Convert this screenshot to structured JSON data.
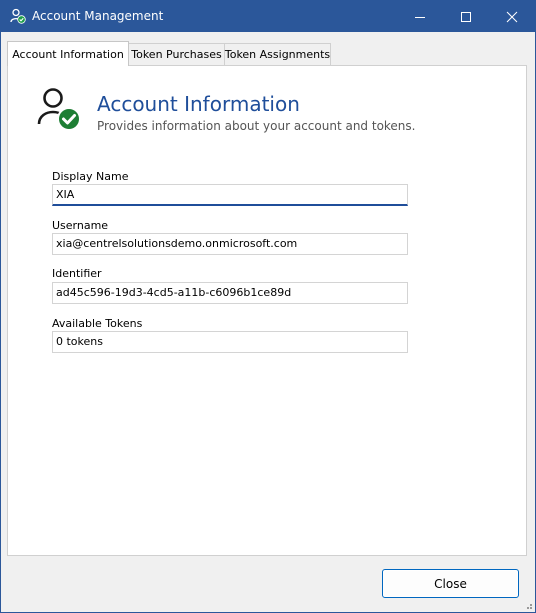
{
  "window": {
    "title": "Account Management"
  },
  "title_buttons": {
    "minimize_icon": "minimize-icon",
    "maximize_icon": "maximize-icon",
    "close_icon": "close-icon"
  },
  "tabs": [
    {
      "label": "Account Information",
      "active": true
    },
    {
      "label": "Token Purchases",
      "active": false
    },
    {
      "label": "Token Assignments",
      "active": false
    }
  ],
  "header": {
    "title": "Account Information",
    "subtitle": "Provides information about your account and tokens.",
    "icon": "user-verified-icon"
  },
  "fields": [
    {
      "label": "Display Name",
      "value": "XIA"
    },
    {
      "label": "Username",
      "value": "xia@centrelsolutionsdemo.onmicrosoft.com"
    },
    {
      "label": "Identifier",
      "value": "ad45c596-19d3-4cd5-a11b-c6096b1ce89d"
    },
    {
      "label": "Available Tokens",
      "value": "0 tokens"
    }
  ],
  "footer": {
    "close_label": "Close"
  },
  "colors": {
    "titlebar": "#2b579a",
    "accent": "#1f4e9a",
    "check_badge": "#1e7e34"
  }
}
